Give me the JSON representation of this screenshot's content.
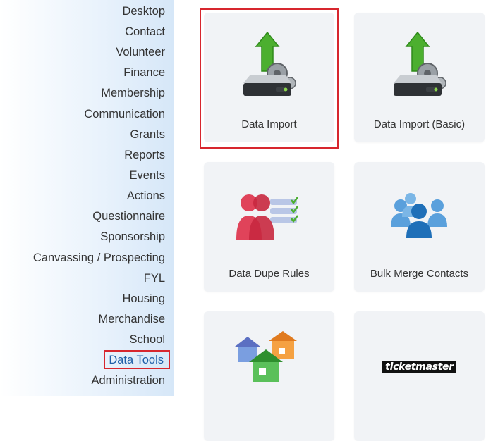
{
  "sidebar": {
    "items": [
      {
        "label": "Desktop"
      },
      {
        "label": "Contact"
      },
      {
        "label": "Volunteer"
      },
      {
        "label": "Finance"
      },
      {
        "label": "Membership"
      },
      {
        "label": "Communication"
      },
      {
        "label": "Grants"
      },
      {
        "label": "Reports"
      },
      {
        "label": "Events"
      },
      {
        "label": "Actions"
      },
      {
        "label": "Questionnaire"
      },
      {
        "label": "Sponsorship"
      },
      {
        "label": "Canvassing / Prospecting"
      },
      {
        "label": "FYL"
      },
      {
        "label": "Housing"
      },
      {
        "label": "Merchandise"
      },
      {
        "label": "School"
      },
      {
        "label": "Data Tools"
      },
      {
        "label": "Administration"
      }
    ],
    "active_label": "Data Tools"
  },
  "tiles": [
    {
      "label": "Data Import",
      "icon": "server-upload-icon",
      "selected": true
    },
    {
      "label": "Data Import (Basic)",
      "icon": "server-upload-icon"
    },
    {
      "label": "Data Dupe Rules",
      "icon": "dupe-people-icon"
    },
    {
      "label": "Bulk Merge Contacts",
      "icon": "merge-people-icon"
    },
    {
      "label": "",
      "icon": "houses-icon"
    },
    {
      "label": "",
      "icon": "ticketmaster-logo",
      "logo_text": "ticketmaster"
    }
  ],
  "colors": {
    "highlight_border": "#d7262e",
    "active_nav": "#1f5fa8",
    "tile_bg": "#f1f3f6"
  }
}
